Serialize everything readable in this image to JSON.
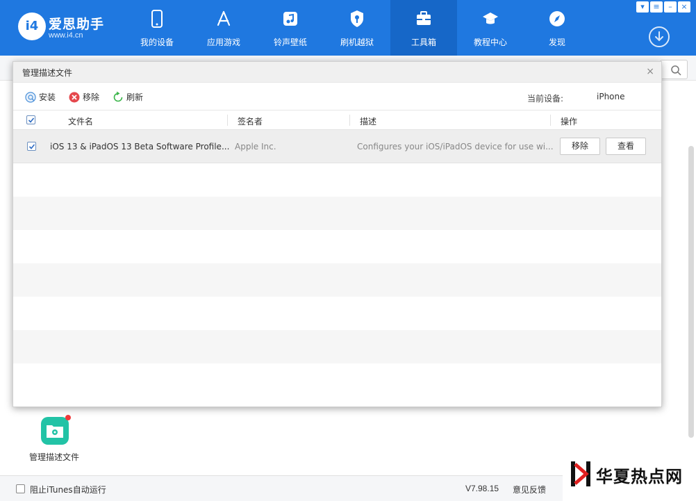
{
  "app": {
    "brand_name": "爱思助手",
    "brand_url": "www.i4.cn",
    "logo_text": "i4"
  },
  "nav": [
    {
      "label": "我的设备",
      "icon": "phone-icon"
    },
    {
      "label": "应用游戏",
      "icon": "app-store-icon"
    },
    {
      "label": "铃声壁纸",
      "icon": "music-note-icon"
    },
    {
      "label": "刷机越狱",
      "icon": "shield-key-icon"
    },
    {
      "label": "工具箱",
      "icon": "toolbox-icon",
      "active": true
    },
    {
      "label": "教程中心",
      "icon": "graduation-cap-icon"
    },
    {
      "label": "发现",
      "icon": "compass-icon"
    }
  ],
  "window_controls": [
    "shirt-icon",
    "menu-icon",
    "minimize-icon",
    "close-icon"
  ],
  "dialog": {
    "title": "管理描述文件",
    "close": "×",
    "toolbar": {
      "install": "安装",
      "remove": "移除",
      "refresh": "刷新",
      "device_label": "当前设备:",
      "device_value": "iPhone"
    },
    "columns": {
      "name": "文件名",
      "signer": "签名者",
      "desc": "描述",
      "action": "操作"
    },
    "rows": [
      {
        "checked": true,
        "name": "iOS 13 & iPadOS 13 Beta Software Profile...",
        "signer": "Apple Inc.",
        "desc": "Configures your iOS/iPadOS device for use wi...",
        "remove": "移除",
        "view": "查看"
      }
    ]
  },
  "background": {
    "tool_label": "管理描述文件"
  },
  "status": {
    "itunes_block": "阻止iTunes自动运行",
    "version": "V7.98.15",
    "feedback": "意见反馈"
  },
  "watermark": {
    "text": "华夏热点网"
  },
  "colors": {
    "header": "#1f78e0",
    "active_nav": "#1667c8",
    "tool_icon": "#22c3a6",
    "badge": "#f0393a"
  }
}
